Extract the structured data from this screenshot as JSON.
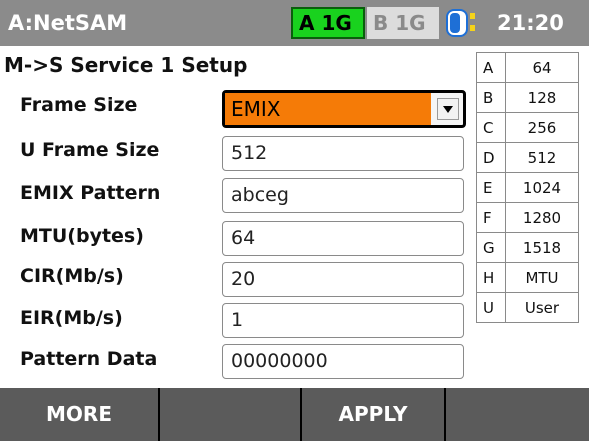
{
  "status_bar": {
    "app_title": "A:NetSAM",
    "port_a": "A 1G",
    "port_b": "B 1G",
    "time": "21:20",
    "battery_icon": "battery-icon"
  },
  "page_title": "M->S Service 1 Setup",
  "form": {
    "frame_size": {
      "label": "Frame Size",
      "value": "EMIX"
    },
    "u_frame_size": {
      "label": "U Frame Size",
      "value": "512"
    },
    "emix_pattern": {
      "label": "EMIX Pattern",
      "value": "abceg"
    },
    "mtu": {
      "label": "MTU(bytes)",
      "value": "64"
    },
    "cir": {
      "label": "CIR(Mb/s)",
      "value": "20"
    },
    "eir": {
      "label": "EIR(Mb/s)",
      "value": "1"
    },
    "pattern_data": {
      "label": "Pattern Data",
      "value": "00000000"
    }
  },
  "emix_table": [
    {
      "key": "A",
      "value": "64"
    },
    {
      "key": "B",
      "value": "128"
    },
    {
      "key": "C",
      "value": "256"
    },
    {
      "key": "D",
      "value": "512"
    },
    {
      "key": "E",
      "value": "1024"
    },
    {
      "key": "F",
      "value": "1280"
    },
    {
      "key": "G",
      "value": "1518"
    },
    {
      "key": "H",
      "value": "MTU"
    },
    {
      "key": "U",
      "value": "User"
    }
  ],
  "softkeys": {
    "key1": "MORE",
    "key2": "",
    "key3": "APPLY",
    "key4": ""
  },
  "colors": {
    "status_bar": "#8b8b8b",
    "port_a_active": "#19d21e",
    "selection_highlight": "#f57b07",
    "softkey_bar": "#5b5b5b"
  }
}
